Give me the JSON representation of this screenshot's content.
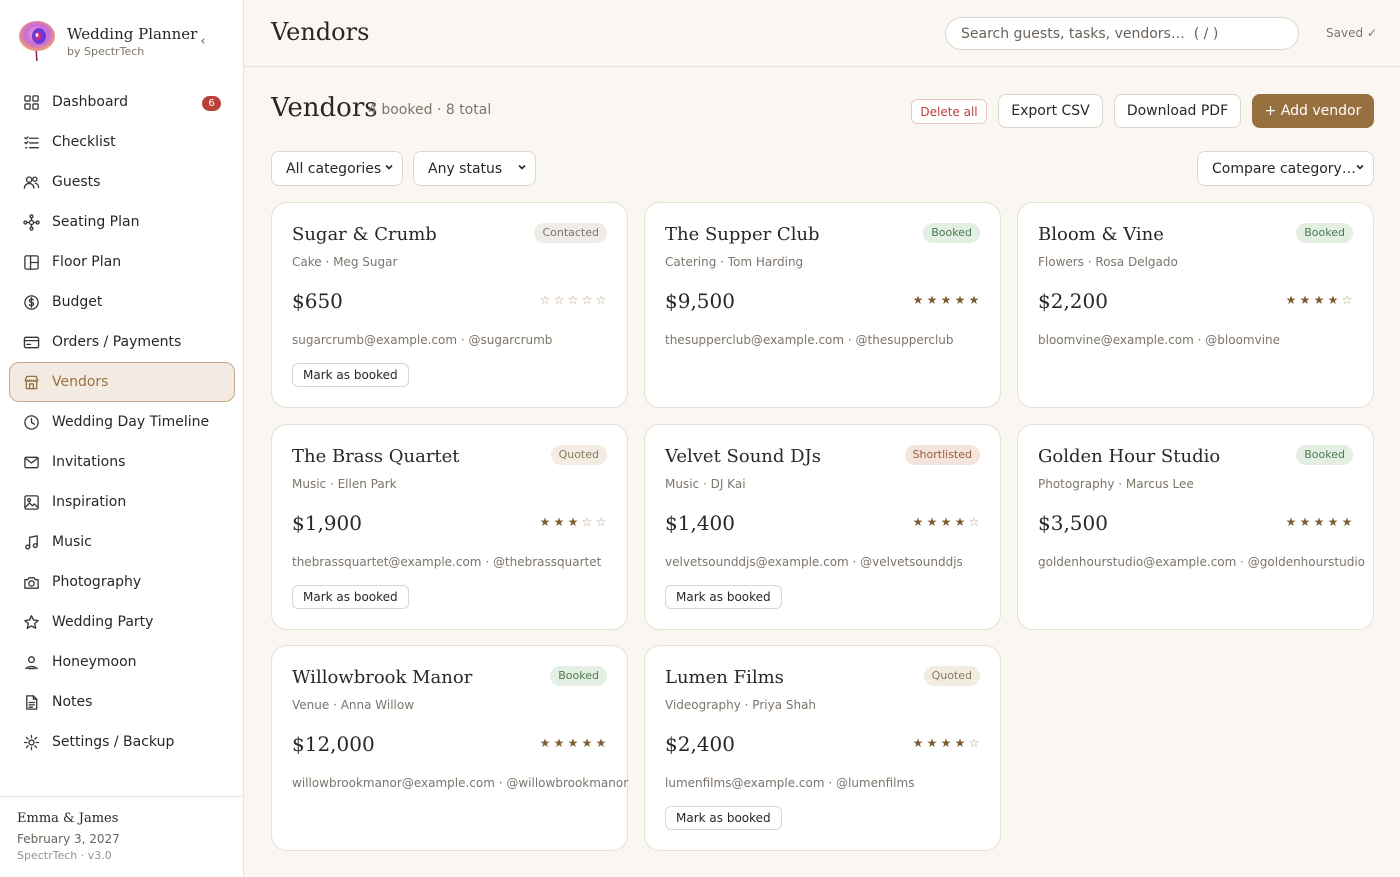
{
  "app": {
    "title": "Wedding Planner",
    "subtitle": "by SpectrTech"
  },
  "sidebar": {
    "items": [
      {
        "label": "Dashboard",
        "icon": "grid-icon",
        "badge": "6"
      },
      {
        "label": "Checklist",
        "icon": "list-check-icon"
      },
      {
        "label": "Guests",
        "icon": "users-icon"
      },
      {
        "label": "Seating Plan",
        "icon": "nodes-icon"
      },
      {
        "label": "Floor Plan",
        "icon": "layout-icon"
      },
      {
        "label": "Budget",
        "icon": "coin-icon"
      },
      {
        "label": "Orders / Payments",
        "icon": "credit-card-icon"
      },
      {
        "label": "Vendors",
        "icon": "store-icon",
        "active": true
      },
      {
        "label": "Wedding Day Timeline",
        "icon": "clock-icon"
      },
      {
        "label": "Invitations",
        "icon": "mail-icon"
      },
      {
        "label": "Inspiration",
        "icon": "image-icon"
      },
      {
        "label": "Music",
        "icon": "music-icon"
      },
      {
        "label": "Photography",
        "icon": "camera-icon"
      },
      {
        "label": "Wedding Party",
        "icon": "star-icon"
      },
      {
        "label": "Honeymoon",
        "icon": "person-pin-icon"
      },
      {
        "label": "Notes",
        "icon": "note-icon"
      },
      {
        "label": "Settings / Backup",
        "icon": "gear-icon"
      }
    ],
    "footer": {
      "couple": "Emma & James",
      "date": "February 3, 2027",
      "version": "SpectrTech · v3.0"
    }
  },
  "header": {
    "title": "Vendors",
    "search_placeholder": "Search guests, tasks, vendors…  ( / )",
    "saved": "Saved ✓"
  },
  "page": {
    "title": "Vendors",
    "counts": "4 booked · 8 total",
    "buttons": {
      "delete_all": "Delete all",
      "export_csv": "Export CSV",
      "download_pdf": "Download PDF",
      "add_vendor": "+ Add vendor"
    },
    "filters": {
      "category": "All categories",
      "status": "Any status",
      "compare": "Compare category…"
    }
  },
  "colors": {
    "accent": "#97703f",
    "danger": "#b8413a",
    "booked": "#4f7a52"
  },
  "vendors": [
    {
      "name": "Sugar & Crumb",
      "category": "Cake · Meg Sugar",
      "status": "Contacted",
      "price": "$650",
      "rating": 0,
      "contact": "sugarcrumb@example.com · @sugarcrumb",
      "action": "Mark as booked"
    },
    {
      "name": "The Supper Club",
      "category": "Catering · Tom Harding",
      "status": "Booked",
      "price": "$9,500",
      "rating": 5,
      "contact": "thesupperclub@example.com · @thesupperclub",
      "action": ""
    },
    {
      "name": "Bloom & Vine",
      "category": "Flowers · Rosa Delgado",
      "status": "Booked",
      "price": "$2,200",
      "rating": 4,
      "contact": "bloomvine@example.com · @bloomvine",
      "action": ""
    },
    {
      "name": "The Brass Quartet",
      "category": "Music · Ellen Park",
      "status": "Quoted",
      "price": "$1,900",
      "rating": 3,
      "contact": "thebrassquartet@example.com · @thebrassquartet",
      "action": "Mark as booked"
    },
    {
      "name": "Velvet Sound DJs",
      "category": "Music · DJ Kai",
      "status": "Shortlisted",
      "price": "$1,400",
      "rating": 4,
      "contact": "velvetsounddjs@example.com · @velvetsounddjs",
      "action": "Mark as booked"
    },
    {
      "name": "Golden Hour Studio",
      "category": "Photography · Marcus Lee",
      "status": "Booked",
      "price": "$3,500",
      "rating": 5,
      "contact": "goldenhourstudio@example.com · @goldenhourstudio",
      "action": ""
    },
    {
      "name": "Willowbrook Manor",
      "category": "Venue · Anna Willow",
      "status": "Booked",
      "price": "$12,000",
      "rating": 5,
      "contact": "willowbrookmanor@example.com · @willowbrookmanor",
      "action": ""
    },
    {
      "name": "Lumen Films",
      "category": "Videography · Priya Shah",
      "status": "Quoted",
      "price": "$2,400",
      "rating": 4,
      "contact": "lumenfilms@example.com · @lumenfilms",
      "action": "Mark as booked"
    }
  ]
}
